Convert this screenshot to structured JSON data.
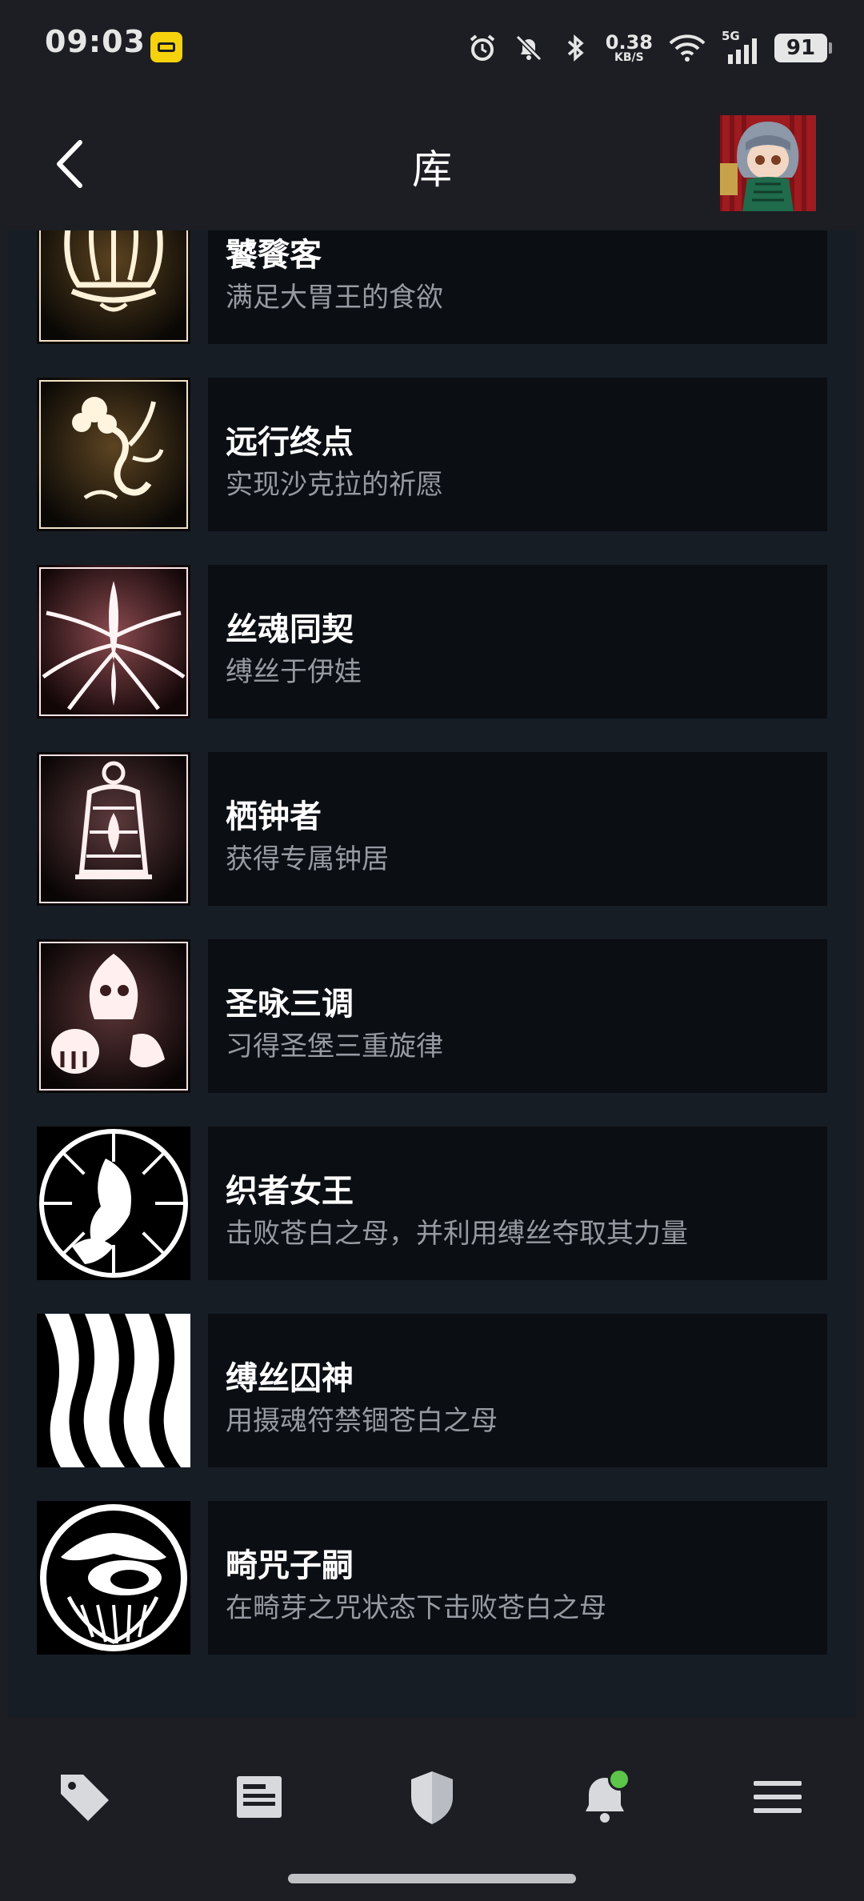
{
  "status_bar": {
    "time": "09:03",
    "net_speed_value": "0.38",
    "net_speed_unit": "KB/S",
    "network_type": "5G",
    "battery": "91",
    "icons": [
      "alarm-icon",
      "mute-icon",
      "bluetooth-icon",
      "wifi-icon",
      "signal-icon"
    ]
  },
  "header": {
    "title": "库",
    "back_icon": "chevron-left-icon",
    "avatar": "user-avatar"
  },
  "achievements": [
    {
      "name": "饕餮客",
      "desc": "满足大胃王的食欲",
      "icon": "crown-icon"
    },
    {
      "name": "远行终点",
      "desc": "实现沙克拉的祈愿",
      "icon": "flower-icon"
    },
    {
      "name": "丝魂同契",
      "desc": "缚丝于伊娃",
      "icon": "spider-icon"
    },
    {
      "name": "栖钟者",
      "desc": "获得专属钟居",
      "icon": "bell-icon"
    },
    {
      "name": "圣咏三调",
      "desc": "习得圣堡三重旋律",
      "icon": "melody-icon"
    },
    {
      "name": "织者女王",
      "desc": "击败苍白之母，并利用缚丝夺取其力量",
      "icon": "weaver-queen-icon"
    },
    {
      "name": "缚丝囚神",
      "desc": "用摄魂符禁锢苍白之母",
      "icon": "bound-silk-icon"
    },
    {
      "name": "畸咒子嗣",
      "desc": "在畸芽之咒状态下击败苍白之母",
      "icon": "cursed-mask-icon"
    }
  ],
  "bottom_nav": [
    {
      "name": "store",
      "icon": "tag-icon"
    },
    {
      "name": "news",
      "icon": "news-icon"
    },
    {
      "name": "guard",
      "icon": "shield-icon"
    },
    {
      "name": "notifications",
      "icon": "bell-notification-icon"
    },
    {
      "name": "menu",
      "icon": "hamburger-menu-icon"
    }
  ],
  "colors": {
    "background": "#1c1e23",
    "content_bg": "#171d25",
    "card_bg": "#0b0e13",
    "desc_text": "#969aa1",
    "notification_dot": "#5cc54a"
  }
}
